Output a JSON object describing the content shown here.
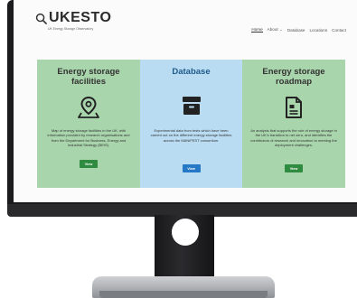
{
  "site": {
    "logo_text": "UKESTO",
    "logo_subtitle": "UK Energy Storage Observatory"
  },
  "nav": {
    "items": [
      {
        "label": "Home",
        "active": true
      },
      {
        "label": "About ⌄",
        "active": false
      },
      {
        "label": "Database",
        "active": false
      },
      {
        "label": "Locations",
        "active": false
      },
      {
        "label": "Contact",
        "active": false
      }
    ]
  },
  "cards": [
    {
      "title": "Energy storage facilities",
      "icon": "map-pin-icon",
      "description": "Map of energy storage facilities in the UK, with information provided by research organisations and from the Department for Business, Energy and Industrial Strategy (BEIS).",
      "button_label": "View"
    },
    {
      "title": "Database",
      "icon": "archive-box-icon",
      "description": "Experimental data from tests which have been carried out on the different energy storage facilities across the MANIFEST consortium.",
      "button_label": "View"
    },
    {
      "title": "Energy storage roadmap",
      "icon": "document-icon",
      "description": "An analysis that supports the role of energy storage in the UK's transition to net zero, and identifies the contributors of research and innovation to meeting the deployment challenges.",
      "button_label": "View"
    }
  ],
  "colors": {
    "card_green": "#a9d5ac",
    "card_blue": "#b9dcf2",
    "button_green": "#2e8b3f",
    "button_blue": "#2478c6",
    "bezel": "#1b1b1d"
  }
}
